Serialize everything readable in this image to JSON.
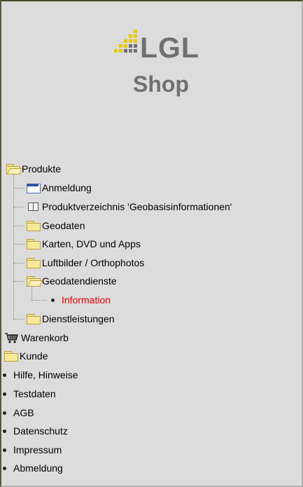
{
  "logo": {
    "title": "LGL",
    "subtitle": "Shop",
    "dot_color": "#e8c800"
  },
  "tree": {
    "root_label": "Produkte",
    "items": [
      {
        "label": "Anmeldung",
        "icon": "window-icon"
      },
      {
        "label": "Produktverzeichnis 'Geobasisinformationen'",
        "icon": "book-icon"
      },
      {
        "label": "Geodaten",
        "icon": "folder-icon"
      },
      {
        "label": "Karten, DVD und Apps",
        "icon": "folder-icon"
      },
      {
        "label": "Luftbilder / Orthophotos",
        "icon": "folder-icon"
      },
      {
        "label": "Geodatendienste",
        "icon": "folder-open-icon"
      },
      {
        "label": "Information",
        "icon": "bullet-icon",
        "active": true
      },
      {
        "label": "Dienstleistungen",
        "icon": "folder-icon"
      }
    ]
  },
  "nav": {
    "warenkorb": "Warenkorb",
    "kunde": "Kunde",
    "links": [
      "Hilfe, Hinweise",
      "Testdaten",
      "AGB",
      "Datenschutz",
      "Impressum",
      "Abmeldung"
    ]
  },
  "colors": {
    "active_link": "#e00000",
    "background": "#dcdcdc"
  }
}
